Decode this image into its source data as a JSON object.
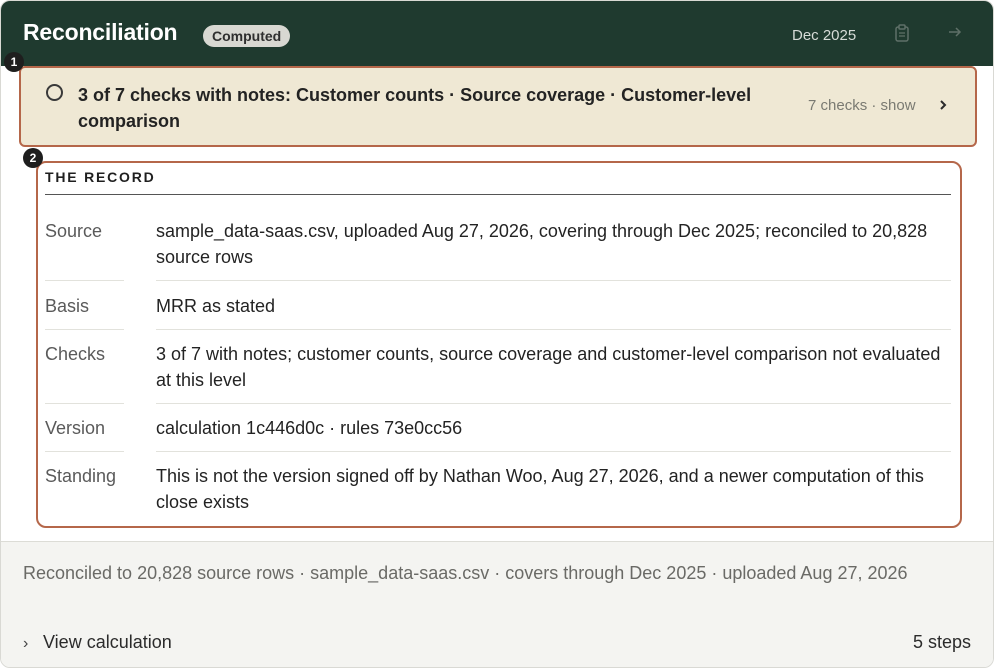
{
  "header": {
    "title": "Reconciliation",
    "status_pill": "Computed",
    "period": "Dec 2025",
    "icons": [
      "clipboard-icon",
      "arrow-right-icon"
    ]
  },
  "markers": [
    "1",
    "2"
  ],
  "checks_banner": {
    "text": "3 of 7 checks with notes: Customer counts · Source coverage · Customer-level comparison",
    "count_label": "7 checks · show"
  },
  "record": {
    "heading": "THE RECORD",
    "rows": [
      {
        "label": "Source",
        "value": "sample_data-saas.csv, uploaded Aug 27, 2026, covering through Dec 2025; reconciled to 20,828 source rows"
      },
      {
        "label": "Basis",
        "value": "MRR as stated"
      },
      {
        "label": "Checks",
        "value": "3 of 7 with notes; customer counts, source coverage and customer-level comparison not evaluated at this level"
      },
      {
        "label": "Version",
        "value": "calculation 1c446d0c · rules 73e0cc56"
      },
      {
        "label": "Standing",
        "value": "This is not the version signed off by Nathan Woo, Aug 27, 2026, and a newer computation of this close exists"
      }
    ]
  },
  "footer": {
    "summary": "Reconciled to 20,828 source rows · sample_data-saas.csv · covers through Dec 2025 · uploaded Aug 27, 2026",
    "view_calculation": "View calculation",
    "steps": "5 steps"
  },
  "colors": {
    "header_bg": "#1f3a2f",
    "banner_bg": "#efe8d4",
    "highlight_border": "#b5674a",
    "footer_bg": "#f4f4f1"
  }
}
